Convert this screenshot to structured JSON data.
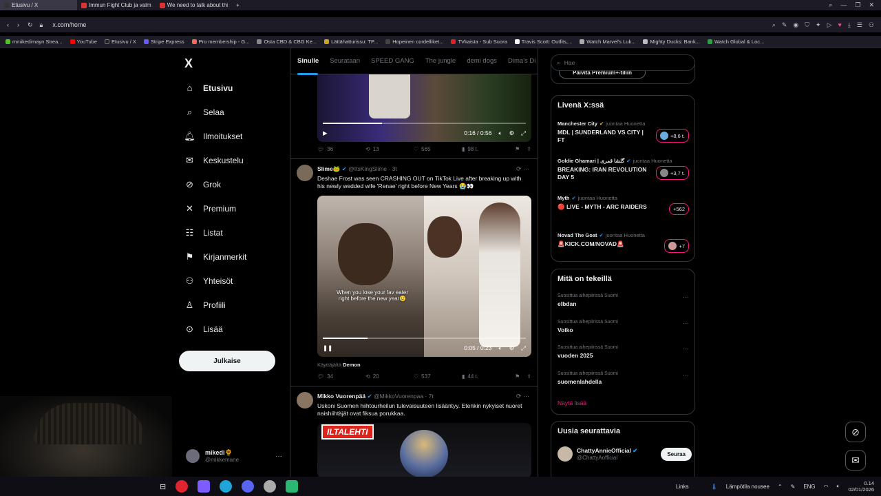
{
  "browser": {
    "tabs": [
      {
        "label": "Etusivu / X",
        "active": true
      },
      {
        "label": "Immun Fight Club ja valm",
        "active": false
      },
      {
        "label": "We need to talk about thi",
        "active": false
      }
    ],
    "new_tab": "+",
    "url": "x.com/home",
    "bookmarks": [
      "mmikedimayn Strea...",
      "YouTube",
      "Etusivu / X",
      "Stripe Express",
      "Pro membership - G...",
      "Osta CBD & CBG Ke...",
      "Lättähatturissu: TP...",
      "Hopeinen cordelliket...",
      "TVkaista - Sub Suora",
      "Travis Scott: Outfits,...",
      "Watch Marvel's Luk...",
      "Mighty Ducks: Bank...",
      "Watch Global & Loc..."
    ]
  },
  "nav": {
    "logo": "X",
    "items": [
      {
        "label": "Etusivu",
        "icon": "home-icon"
      },
      {
        "label": "Selaa",
        "icon": "search-icon"
      },
      {
        "label": "Ilmoitukset",
        "icon": "bell-icon"
      },
      {
        "label": "Keskustelu",
        "icon": "mail-icon"
      },
      {
        "label": "Grok",
        "icon": "grok-icon"
      },
      {
        "label": "Premium",
        "icon": "x-premium-icon"
      },
      {
        "label": "Listat",
        "icon": "list-icon"
      },
      {
        "label": "Kirjanmerkit",
        "icon": "bookmark-icon"
      },
      {
        "label": "Yhteisöt",
        "icon": "communities-icon"
      },
      {
        "label": "Profiili",
        "icon": "profile-icon"
      },
      {
        "label": "Lisää",
        "icon": "more-icon"
      }
    ],
    "post_button": "Julkaise",
    "account": {
      "name": "mikedi🌻",
      "handle": "@mikkemane",
      "more": "···"
    }
  },
  "feed": {
    "tabs": [
      "Sinulle",
      "Seurataan",
      "SPEED GANG",
      "The jungle",
      "demi dogs",
      "Dima's Di"
    ],
    "video1": {
      "time": "0:16 / 0:56",
      "progress": 0.29
    },
    "tweet0_actions": {
      "replies": "36",
      "reposts": "13",
      "likes": "565",
      "views": "98 t."
    },
    "tweet1": {
      "name": "Slime🐸",
      "handle": "@ItsKingSlime · 3t",
      "text": "Deshae Frost was seen CRASHING OUT on TikTok Live after breaking up with his newly wedded wife 'Renae' right before New Years 😭👀",
      "caption": "When you lose your fav eater right before the new year😢",
      "time": "0:05 / 0:23",
      "progress": 0.22,
      "used_by_label": "Käyttäjältä",
      "used_by": "Demon",
      "replies": "34",
      "reposts": "20",
      "likes": "537",
      "views": "44 t."
    },
    "tweet2": {
      "name": "Mikko Vuorenpää",
      "handle": "@MikkoVuorenpaa · 7t",
      "text": "Uskoni Suomen hiihtourheilun tulevaisuuteen lisääntyy. Etenkin nykyiset nuoret naishiihtäjät ovat fiksua porukkaa.",
      "logo": "ILTALEHTI"
    }
  },
  "sidebar": {
    "search_placeholder": "Hae",
    "premium_btn": "Päivitä Premium+-tiliin",
    "live": {
      "title": "Livenä X:ssä",
      "following": "juontaa Huonetta",
      "items": [
        {
          "host": "Manchester City",
          "title": "MDL | SUNDERLAND VS CITY | FT",
          "count": "+8,6 t."
        },
        {
          "host": "Goldie Ghamari | گلشا قمری",
          "title": "BREAKING: IRAN REVOLUTION DAY 5",
          "count": "+3,7 t."
        },
        {
          "host": "Myth",
          "title": "🔴 LIVE - MYTH - ARC RAIDERS",
          "count": "+562"
        },
        {
          "host": "Novad The Goat",
          "title": "🚨KICK.COM/NOVAD🚨",
          "count": "+7"
        }
      ]
    },
    "trends": {
      "title": "Mitä on tekeillä",
      "items": [
        {
          "sub": "Suosittua aihepiirissä Suomi",
          "topic": "elbdan"
        },
        {
          "sub": "Suosittua aihepiirissä Suomi",
          "topic": "Voiko"
        },
        {
          "sub": "Suosittua aihepiirissä Suomi",
          "topic": "vuoden 2025"
        },
        {
          "sub": "Suosittua aihepiirissä Suomi",
          "topic": "suomenlahdella"
        }
      ],
      "show_more": "Näytä lisää"
    },
    "who_to_follow": {
      "title": "Uusia seurattavia",
      "items": [
        {
          "name": "ChattyAnnieOfficial",
          "handle": "@ChattyAofficial",
          "button": "Seuraa"
        }
      ]
    }
  },
  "taskbar": {
    "links": "Links",
    "weather": "Lämpötila nousee",
    "lang": "ENG",
    "time": "0.14",
    "date": "02/01/2026"
  }
}
